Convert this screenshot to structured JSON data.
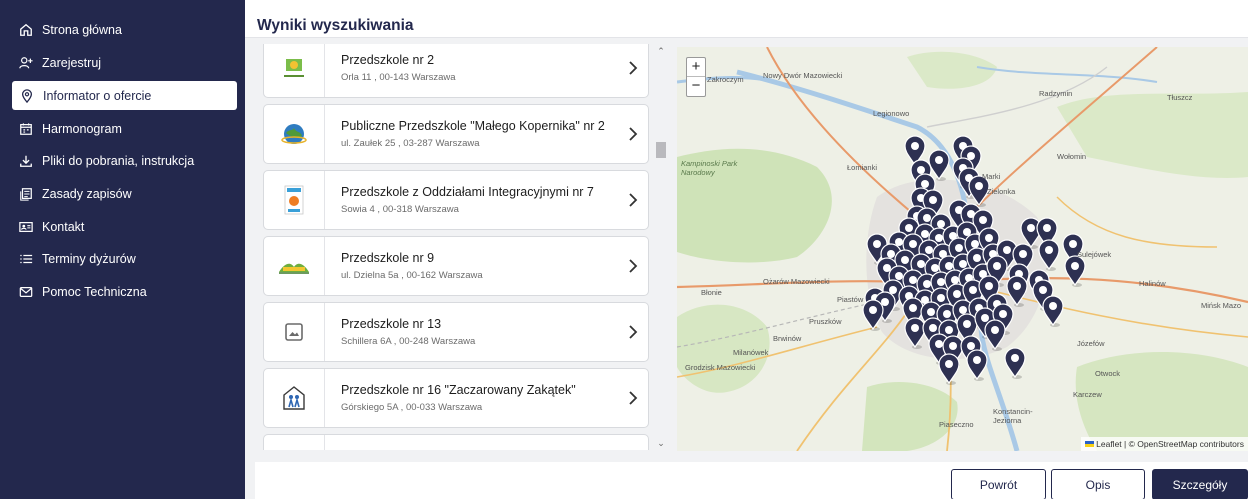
{
  "sidebar": {
    "items": [
      {
        "label": "Strona główna",
        "icon": "home-icon"
      },
      {
        "label": "Zarejestruj",
        "icon": "add-person-icon"
      },
      {
        "label": "Informator o ofercie",
        "icon": "location-icon"
      },
      {
        "label": "Harmonogram",
        "icon": "calendar-icon"
      },
      {
        "label": "Pliki do pobrania, instrukcja",
        "icon": "download-icon"
      },
      {
        "label": "Zasady zapisów",
        "icon": "document-icon"
      },
      {
        "label": "Kontakt",
        "icon": "contact-card-icon"
      },
      {
        "label": "Terminy dyżurów",
        "icon": "list-icon"
      },
      {
        "label": "Pomoc Techniczna",
        "icon": "mail-icon"
      }
    ],
    "active_index": 2
  },
  "header": {
    "title": "Wyniki wyszukiwania"
  },
  "results": [
    {
      "name": "Przedszkole nr 2",
      "address": "Orla 11 , 00-143 Warszawa"
    },
    {
      "name": "Publiczne Przedszkole \"Małego Kopernika\" nr 2",
      "address": "ul. Zaułek 25 , 03-287 Warszawa"
    },
    {
      "name": "Przedszkole z Oddziałami Integracyjnymi nr 7",
      "address": "Sowia 4 , 00-318 Warszawa"
    },
    {
      "name": "Przedszkole nr 9",
      "address": "ul. Dzielna 5a , 00-162 Warszawa"
    },
    {
      "name": "Przedszkole nr 13",
      "address": "Schillera 6A , 00-248 Warszawa"
    },
    {
      "name": "Przedszkole nr 16 \"Zaczarowany Zakątek\"",
      "address": "Górskiego 5A , 00-033 Warszawa"
    }
  ],
  "map": {
    "zoom_in": "+",
    "zoom_out": "−",
    "attribution": "Leaflet | © OpenStreetMap contributors",
    "labels": {
      "nowy_dwor": "Nowy Dwór Mazowiecki",
      "legionowo": "Legionowo",
      "kampinoski": "Kampinoski Park Narodowy",
      "lomianki": "Łomianki",
      "marki": "Marki",
      "zielonka": "Zielonka",
      "wolomin": "Wołomin",
      "radzymin": "Radzymin",
      "tluszcz": "Tłuszcz",
      "blonie": "Błonie",
      "ozarow": "Ożarów Mazowiecki",
      "piastow": "Piastów",
      "pruszkow": "Pruszków",
      "milanowek": "Milanówek",
      "grodzisk": "Grodzisk Mazowiecki",
      "piaseczno": "Piaseczno",
      "konstancin": "Konstancin-Jeziorna",
      "jozefow": "Józefów",
      "otwock": "Otwock",
      "karczew": "Karczew",
      "halinow": "Halinów",
      "minsk": "Mińsk Mazo",
      "brwinow": "Brwinów",
      "sulejowek": "Sulejówek",
      "zakroczym": "Zakroczym"
    }
  },
  "footer": {
    "back": "Powrót",
    "description": "Opis",
    "details": "Szczegóły"
  },
  "colors": {
    "sidebar_bg": "#23284d",
    "accent": "#23284d",
    "marker": "#2e3152"
  }
}
